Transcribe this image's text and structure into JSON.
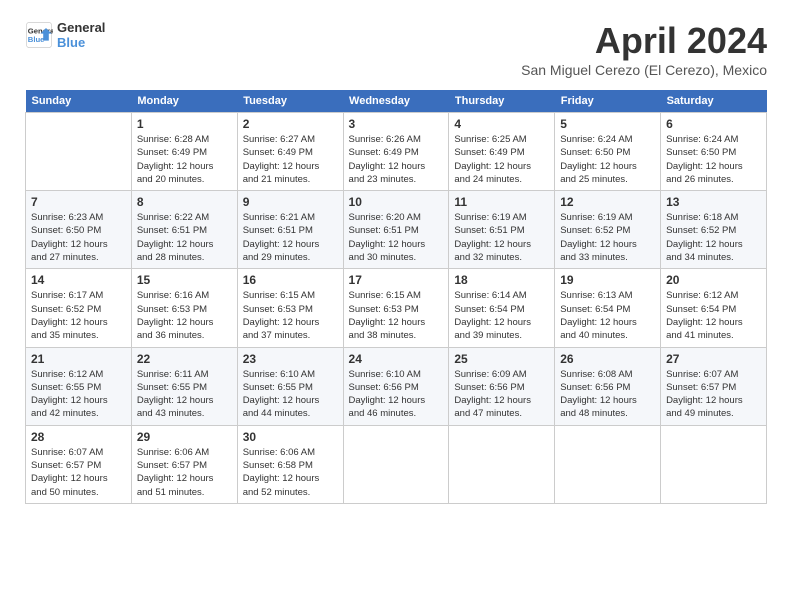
{
  "header": {
    "logo_line1": "General",
    "logo_line2": "Blue",
    "month": "April 2024",
    "location": "San Miguel Cerezo (El Cerezo), Mexico"
  },
  "days_of_week": [
    "Sunday",
    "Monday",
    "Tuesday",
    "Wednesday",
    "Thursday",
    "Friday",
    "Saturday"
  ],
  "weeks": [
    [
      {
        "date": "",
        "info": ""
      },
      {
        "date": "1",
        "info": "Sunrise: 6:28 AM\nSunset: 6:49 PM\nDaylight: 12 hours\nand 20 minutes."
      },
      {
        "date": "2",
        "info": "Sunrise: 6:27 AM\nSunset: 6:49 PM\nDaylight: 12 hours\nand 21 minutes."
      },
      {
        "date": "3",
        "info": "Sunrise: 6:26 AM\nSunset: 6:49 PM\nDaylight: 12 hours\nand 23 minutes."
      },
      {
        "date": "4",
        "info": "Sunrise: 6:25 AM\nSunset: 6:49 PM\nDaylight: 12 hours\nand 24 minutes."
      },
      {
        "date": "5",
        "info": "Sunrise: 6:24 AM\nSunset: 6:50 PM\nDaylight: 12 hours\nand 25 minutes."
      },
      {
        "date": "6",
        "info": "Sunrise: 6:24 AM\nSunset: 6:50 PM\nDaylight: 12 hours\nand 26 minutes."
      }
    ],
    [
      {
        "date": "7",
        "info": "Sunrise: 6:23 AM\nSunset: 6:50 PM\nDaylight: 12 hours\nand 27 minutes."
      },
      {
        "date": "8",
        "info": "Sunrise: 6:22 AM\nSunset: 6:51 PM\nDaylight: 12 hours\nand 28 minutes."
      },
      {
        "date": "9",
        "info": "Sunrise: 6:21 AM\nSunset: 6:51 PM\nDaylight: 12 hours\nand 29 minutes."
      },
      {
        "date": "10",
        "info": "Sunrise: 6:20 AM\nSunset: 6:51 PM\nDaylight: 12 hours\nand 30 minutes."
      },
      {
        "date": "11",
        "info": "Sunrise: 6:19 AM\nSunset: 6:51 PM\nDaylight: 12 hours\nand 32 minutes."
      },
      {
        "date": "12",
        "info": "Sunrise: 6:19 AM\nSunset: 6:52 PM\nDaylight: 12 hours\nand 33 minutes."
      },
      {
        "date": "13",
        "info": "Sunrise: 6:18 AM\nSunset: 6:52 PM\nDaylight: 12 hours\nand 34 minutes."
      }
    ],
    [
      {
        "date": "14",
        "info": "Sunrise: 6:17 AM\nSunset: 6:52 PM\nDaylight: 12 hours\nand 35 minutes."
      },
      {
        "date": "15",
        "info": "Sunrise: 6:16 AM\nSunset: 6:53 PM\nDaylight: 12 hours\nand 36 minutes."
      },
      {
        "date": "16",
        "info": "Sunrise: 6:15 AM\nSunset: 6:53 PM\nDaylight: 12 hours\nand 37 minutes."
      },
      {
        "date": "17",
        "info": "Sunrise: 6:15 AM\nSunset: 6:53 PM\nDaylight: 12 hours\nand 38 minutes."
      },
      {
        "date": "18",
        "info": "Sunrise: 6:14 AM\nSunset: 6:54 PM\nDaylight: 12 hours\nand 39 minutes."
      },
      {
        "date": "19",
        "info": "Sunrise: 6:13 AM\nSunset: 6:54 PM\nDaylight: 12 hours\nand 40 minutes."
      },
      {
        "date": "20",
        "info": "Sunrise: 6:12 AM\nSunset: 6:54 PM\nDaylight: 12 hours\nand 41 minutes."
      }
    ],
    [
      {
        "date": "21",
        "info": "Sunrise: 6:12 AM\nSunset: 6:55 PM\nDaylight: 12 hours\nand 42 minutes."
      },
      {
        "date": "22",
        "info": "Sunrise: 6:11 AM\nSunset: 6:55 PM\nDaylight: 12 hours\nand 43 minutes."
      },
      {
        "date": "23",
        "info": "Sunrise: 6:10 AM\nSunset: 6:55 PM\nDaylight: 12 hours\nand 44 minutes."
      },
      {
        "date": "24",
        "info": "Sunrise: 6:10 AM\nSunset: 6:56 PM\nDaylight: 12 hours\nand 46 minutes."
      },
      {
        "date": "25",
        "info": "Sunrise: 6:09 AM\nSunset: 6:56 PM\nDaylight: 12 hours\nand 47 minutes."
      },
      {
        "date": "26",
        "info": "Sunrise: 6:08 AM\nSunset: 6:56 PM\nDaylight: 12 hours\nand 48 minutes."
      },
      {
        "date": "27",
        "info": "Sunrise: 6:07 AM\nSunset: 6:57 PM\nDaylight: 12 hours\nand 49 minutes."
      }
    ],
    [
      {
        "date": "28",
        "info": "Sunrise: 6:07 AM\nSunset: 6:57 PM\nDaylight: 12 hours\nand 50 minutes."
      },
      {
        "date": "29",
        "info": "Sunrise: 6:06 AM\nSunset: 6:57 PM\nDaylight: 12 hours\nand 51 minutes."
      },
      {
        "date": "30",
        "info": "Sunrise: 6:06 AM\nSunset: 6:58 PM\nDaylight: 12 hours\nand 52 minutes."
      },
      {
        "date": "",
        "info": ""
      },
      {
        "date": "",
        "info": ""
      },
      {
        "date": "",
        "info": ""
      },
      {
        "date": "",
        "info": ""
      }
    ]
  ]
}
